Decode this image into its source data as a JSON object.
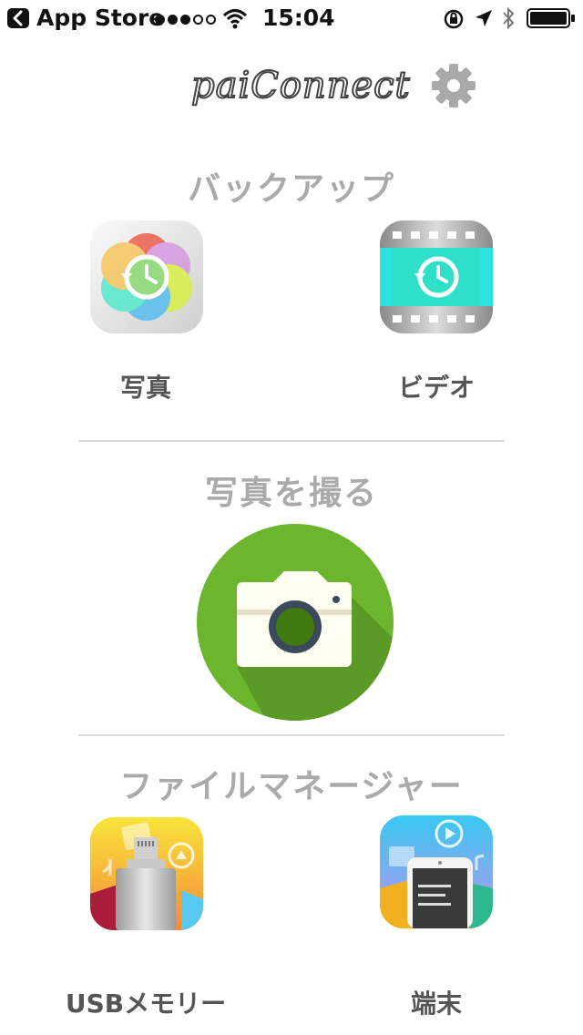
{
  "status_bar": {
    "back_label": "App Store",
    "time": "15:04",
    "signal_dots": [
      true,
      true,
      true,
      false,
      false
    ]
  },
  "header": {
    "logo_text": "paiConnect"
  },
  "sections": {
    "backup": {
      "title": "バックアップ",
      "items": [
        {
          "label": "写真",
          "icon": "photo-backup-icon"
        },
        {
          "label": "ビデオ",
          "icon": "video-backup-icon"
        }
      ]
    },
    "camera": {
      "title": "写真を撮る",
      "icon": "camera-icon"
    },
    "file_manager": {
      "title": "ファイルマネージャー",
      "items": [
        {
          "label": "USBメモリー",
          "icon": "usb-memory-icon"
        },
        {
          "label": "端末",
          "icon": "device-icon"
        }
      ]
    }
  },
  "colors": {
    "camera_green": "#6cb62e",
    "camera_shadow": "#5a9a26",
    "section_title": "#aaaaaa",
    "divider": "#d9d9d9"
  }
}
